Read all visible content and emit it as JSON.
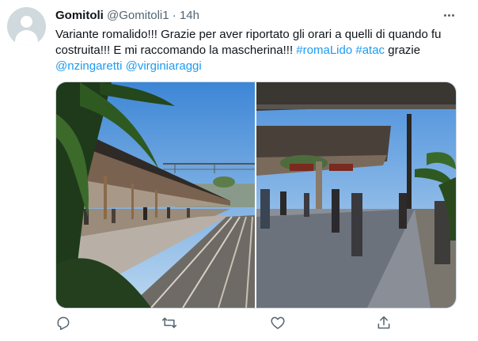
{
  "tweet": {
    "author_name": "Gomitoli",
    "author_handle": "@Gomitoli1",
    "separator": "·",
    "time": "14h",
    "text_part1": "Variante romalido!!! Grazie per aver riportato gli orari a quelli di quando fu costruita!!! E mi raccomando la mascherina!!! ",
    "hashtag_1": "#romaLido",
    "space": " ",
    "hashtag_2": "#atac",
    "text_part2": " grazie ",
    "mention_1": "@nzingaretti",
    "mention_2": "@virginiaraggi"
  },
  "icons": {
    "avatar": "default-avatar-icon",
    "more": "more-icon",
    "reply": "reply-icon",
    "retweet": "retweet-icon",
    "like": "heart-icon",
    "share": "share-icon"
  },
  "colors": {
    "link": "#1d9bf0",
    "secondary_text": "#536471",
    "text": "#0f1419"
  }
}
